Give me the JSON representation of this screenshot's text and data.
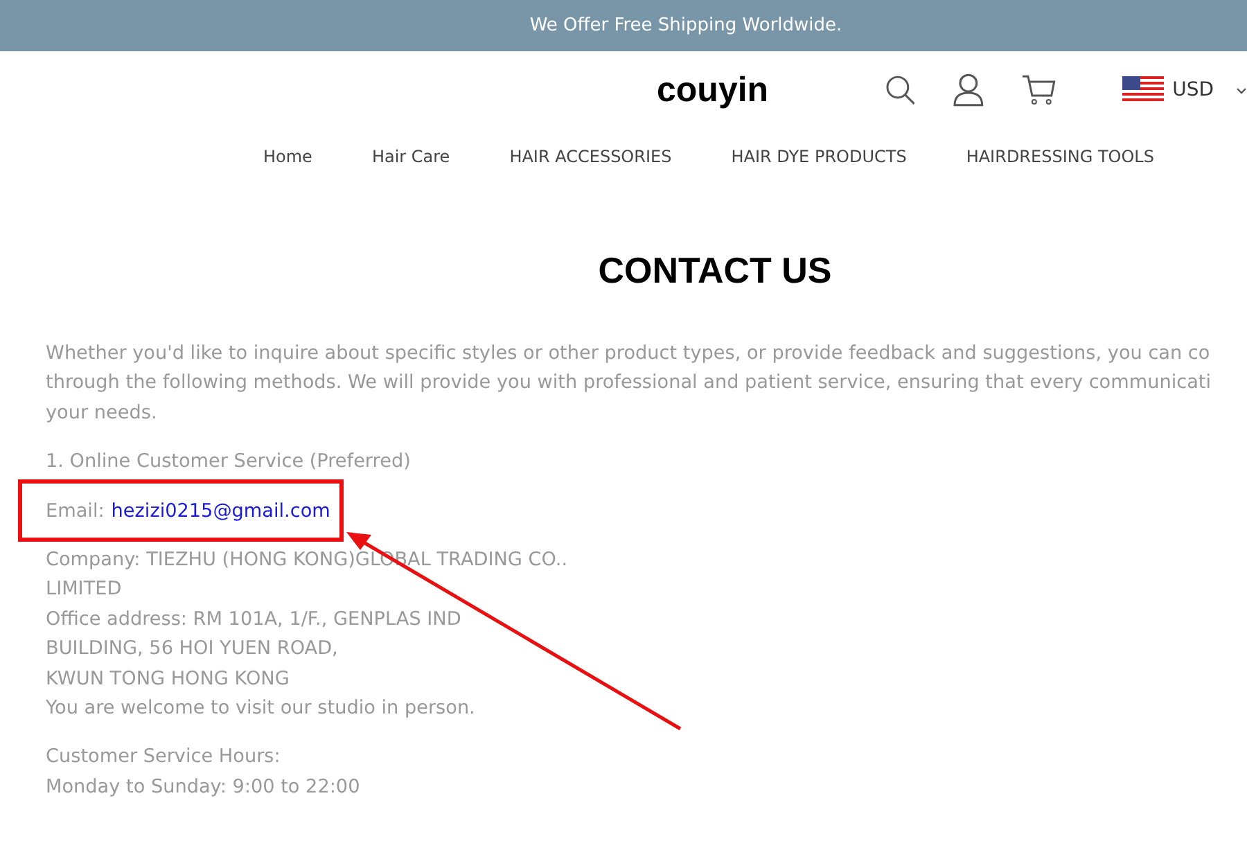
{
  "announcement": "We Offer Free Shipping Worldwide.",
  "header": {
    "logo": "couyin",
    "currency": "USD"
  },
  "nav": [
    {
      "label": "Home"
    },
    {
      "label": "Hair Care"
    },
    {
      "label": "HAIR ACCESSORIES"
    },
    {
      "label": "HAIR DYE PRODUCTS"
    },
    {
      "label": "HAIRDRESSING TOOLS"
    }
  ],
  "page_title": "CONTACT US",
  "intro_lines": [
    "Whether you'd like to inquire about specific styles or other product types, or provide feedback and suggestions, you can co",
    "through the following methods. We will provide you with professional and patient service, ensuring that every communicati",
    "your needs."
  ],
  "section_heading": "1. Online Customer Service (Preferred)",
  "email": {
    "label": "Email:",
    "address": "hezizi0215@gmail.com"
  },
  "company_lines": [
    "Company: TIEZHU (HONG KONG)GLOBAL TRADING CO..",
    "LIMITED",
    "Office address: RM 101A, 1/F., GENPLAS IND",
    "BUILDING, 56 HOI YUEN ROAD,",
    "KWUN TONG HONG KONG",
    "You are welcome to visit our studio in person."
  ],
  "hours_lines": [
    "Customer Service Hours:",
    "Monday to Sunday: 9:00 to 22:00"
  ],
  "annotations": {
    "highlight_box": true,
    "arrow": true
  }
}
